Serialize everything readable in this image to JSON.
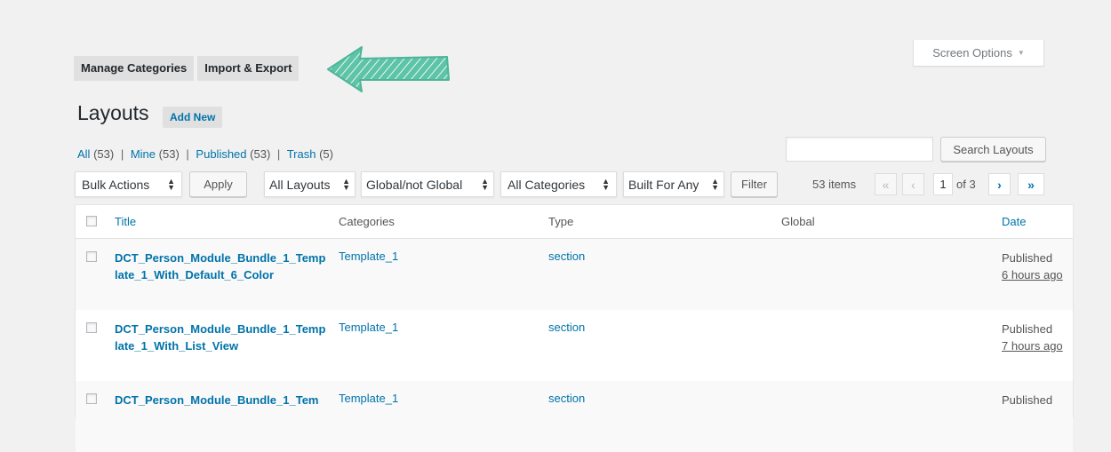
{
  "screen_options": {
    "label": "Screen Options",
    "caret": "▼"
  },
  "top_tabs": [
    {
      "label": "Manage Categories"
    },
    {
      "label": "Import & Export"
    }
  ],
  "arrow_icon": "arrow-left-icon",
  "page": {
    "title": "Layouts",
    "add_new": "Add New"
  },
  "views": {
    "all": {
      "label": "All",
      "count": "(53)"
    },
    "mine": {
      "label": "Mine",
      "count": "(53)"
    },
    "published": {
      "label": "Published",
      "count": "(53)"
    },
    "trash": {
      "label": "Trash",
      "count": "(5)"
    },
    "separator": "|"
  },
  "search": {
    "button": "Search Layouts",
    "value": ""
  },
  "filters": {
    "bulk_actions": "Bulk Actions",
    "apply": "Apply",
    "layouts": "All Layouts",
    "global": "Global/not Global",
    "categories": "All Categories",
    "built_for": "Built For Any",
    "filter": "Filter"
  },
  "pagination": {
    "items": "53 items",
    "first": "«",
    "prev": "‹",
    "current": "1",
    "of": "of 3",
    "next": "›",
    "last": "»"
  },
  "table": {
    "headers": {
      "title": "Title",
      "categories": "Categories",
      "type": "Type",
      "global": "Global",
      "date": "Date"
    },
    "rows": [
      {
        "title": "DCT_Person_Module_Bundle_1_Template_1_With_Default_6_Color",
        "category": "Template_1",
        "type": "section",
        "status": "Published",
        "ago": "6 hours ago"
      },
      {
        "title": "DCT_Person_Module_Bundle_1_Template_1_With_List_View",
        "category": "Template_1",
        "type": "section",
        "status": "Published",
        "ago": "7 hours ago"
      },
      {
        "title": "DCT_Person_Module_Bundle_1_Tem",
        "category": "Template_1",
        "type": "section",
        "status": "Published",
        "ago": ""
      }
    ]
  },
  "colors": {
    "link": "#0073aa",
    "arrow": "#5ec4a8",
    "background": "#f1f1f1"
  }
}
